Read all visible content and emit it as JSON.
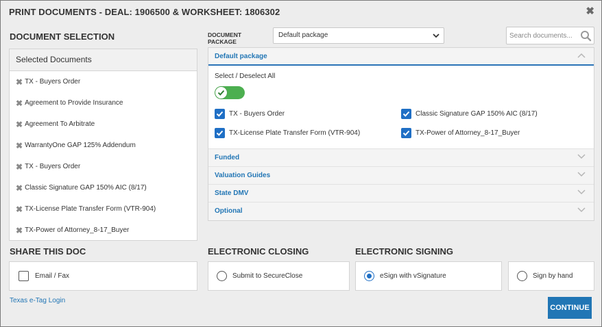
{
  "dialog": {
    "title": "PRINT DOCUMENTS - DEAL: 1906500 & WORKSHEET: 1806302",
    "close_icon": "close-icon"
  },
  "document_selection": {
    "heading": "DOCUMENT SELECTION",
    "list_header": "Selected Documents",
    "items": [
      "TX - Buyers Order",
      "Agreement to Provide Insurance",
      "Agreement To Arbitrate",
      "WarrantyOne GAP 125% Addendum",
      "TX - Buyers Order",
      "Classic Signature GAP 150% AIC (8/17)",
      "TX-License Plate Transfer Form (VTR-904)",
      "TX-Power of Attorney_8-17_Buyer"
    ]
  },
  "package": {
    "label_line1": "DOCUMENT",
    "label_line2": "PACKAGE",
    "selected": "Default package",
    "search_placeholder": "Search documents..."
  },
  "accordion": {
    "open_section": "Default package",
    "select_all_label": "Select / Deselect All",
    "select_all_on": true,
    "checkboxes": [
      {
        "label": "TX - Buyers Order",
        "checked": true
      },
      {
        "label": "Classic Signature GAP 150% AIC (8/17)",
        "checked": true
      },
      {
        "label": "TX-License Plate Transfer Form (VTR-904)",
        "checked": true
      },
      {
        "label": "TX-Power of Attorney_8-17_Buyer",
        "checked": true
      }
    ],
    "collapsed_sections": [
      "Funded",
      "Valuation Guides",
      "State DMV",
      "Optional"
    ]
  },
  "share": {
    "heading": "SHARE THIS DOC",
    "email_fax_label": "Email / Fax",
    "email_fax_checked": false
  },
  "electronic_closing": {
    "heading": "ELECTRONIC CLOSING",
    "option_label": "Submit to SecureClose",
    "selected": false
  },
  "electronic_signing": {
    "heading": "ELECTRONIC SIGNING",
    "esign_label": "eSign with vSignature",
    "esign_selected": true,
    "hand_label": "Sign by hand",
    "hand_selected": false
  },
  "footer": {
    "etag_link": "Texas e-Tag Login",
    "continue_label": "CONTINUE"
  },
  "colors": {
    "accent_blue": "#2176b5",
    "toggle_green": "#4caf50",
    "checkbox_blue": "#1f6fc5"
  }
}
